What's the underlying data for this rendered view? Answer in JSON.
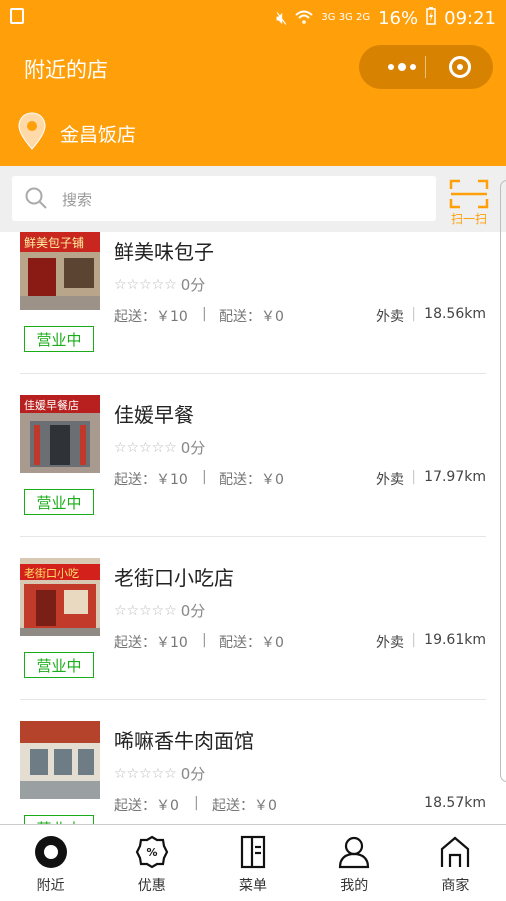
{
  "status_bar": {
    "network": "3G 3G 2G",
    "battery": "16%",
    "time": "09:21"
  },
  "header": {
    "title": "附近的店"
  },
  "location": {
    "name": "金昌饭店"
  },
  "search": {
    "placeholder": "搜索",
    "scan_label": "扫一扫"
  },
  "shops": [
    {
      "name": "鲜美味包子",
      "rating_stars": 0,
      "score": "0分",
      "min_order": "起送：￥10",
      "delivery_fee": "配送：￥0",
      "type": "外卖",
      "distance": "18.56km",
      "status": "营业中"
    },
    {
      "name": "佳媛早餐",
      "rating_stars": 0,
      "score": "0分",
      "min_order": "起送：￥10",
      "delivery_fee": "配送：￥0",
      "type": "外卖",
      "distance": "17.97km",
      "status": "营业中"
    },
    {
      "name": "老街口小吃店",
      "rating_stars": 0,
      "score": "0分",
      "min_order": "起送：￥10",
      "delivery_fee": "配送：￥0",
      "type": "外卖",
      "distance": "19.61km",
      "status": "营业中"
    },
    {
      "name": "唏嘛香牛肉面馆",
      "rating_stars": 0,
      "score": "0分",
      "min_order": "起送：￥0",
      "delivery_fee": "起送：￥0",
      "type": "",
      "distance": "18.57km",
      "status": "营业中"
    }
  ],
  "tabbar": {
    "items": [
      {
        "label": "附近",
        "icon": "nearby-icon",
        "active": true
      },
      {
        "label": "优惠",
        "icon": "discount-badge-icon",
        "active": false
      },
      {
        "label": "菜单",
        "icon": "menu-doc-icon",
        "active": false
      },
      {
        "label": "我的",
        "icon": "user-icon",
        "active": false
      },
      {
        "label": "商家",
        "icon": "shop-icon",
        "active": false
      }
    ]
  },
  "colors": {
    "brand": "#ff9f0a",
    "brand_dark": "#d78200",
    "open_green": "#1aad19"
  }
}
